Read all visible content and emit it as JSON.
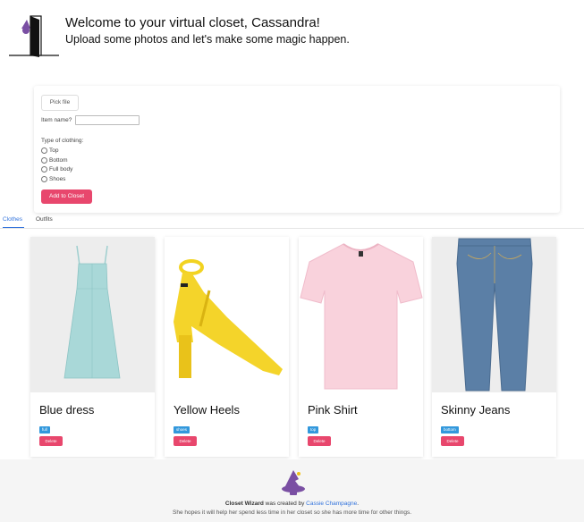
{
  "header": {
    "welcome": "Welcome to your virtual closet, Cassandra!",
    "subtitle": "Upload some photos and let's make some magic happen."
  },
  "upload": {
    "pick_file": "Pick file",
    "item_name_label": "Item name?",
    "item_name_value": "",
    "type_label": "Type of clothing:",
    "types": [
      "Top",
      "Bottom",
      "Full body",
      "Shoes"
    ],
    "add_button": "Add to Closet"
  },
  "tabs": [
    "Clothes",
    "Outfits"
  ],
  "cards": [
    {
      "title": "Blue dress",
      "tag": "full",
      "delete": "Delete"
    },
    {
      "title": "Yellow Heels",
      "tag": "shoes",
      "delete": "Delete"
    },
    {
      "title": "Pink Shirt",
      "tag": "top",
      "delete": "Delete"
    },
    {
      "title": "Skinny Jeans",
      "tag": "bottom",
      "delete": "Delete"
    }
  ],
  "footer": {
    "brand": "Closet Wizard",
    "created_by": " was created by ",
    "author": "Cassie Champagne",
    "period": ".",
    "tagline": "She hopes it will help her spend less time in her closet so she has more time for other things."
  },
  "icons": {
    "logo": "closet-door-wizard-icon",
    "footer_logo": "wizard-hat-icon"
  },
  "colors": {
    "accent": "#e8476d",
    "link": "#3273dc",
    "tag": "#3298dc"
  }
}
